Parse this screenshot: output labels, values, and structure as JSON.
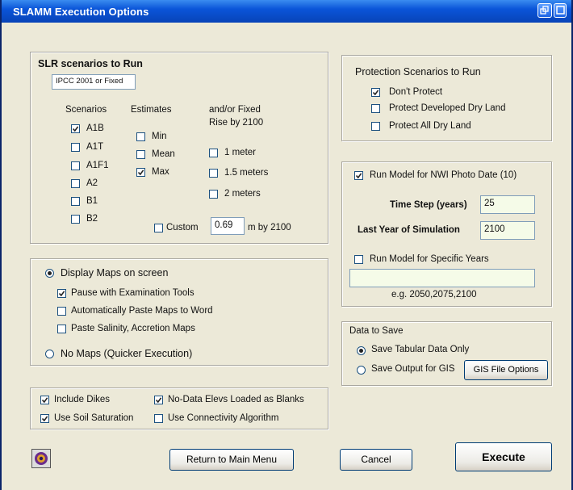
{
  "window": {
    "title": "SLAMM Execution Options"
  },
  "slr": {
    "header": "SLR scenarios to Run",
    "ipcc_box": "IPCC 2001 or Fixed",
    "col_scenarios": "Scenarios",
    "col_estimates": "Estimates",
    "col_fixed_line1": "and/or Fixed",
    "col_fixed_line2": "Rise by 2100",
    "scenarios": [
      {
        "label": "A1B",
        "checked": true
      },
      {
        "label": "A1T",
        "checked": false
      },
      {
        "label": "A1F1",
        "checked": false
      },
      {
        "label": "A2",
        "checked": false
      },
      {
        "label": "B1",
        "checked": false
      },
      {
        "label": "B2",
        "checked": false
      }
    ],
    "estimates": [
      {
        "label": "Min",
        "checked": false
      },
      {
        "label": "Mean",
        "checked": false
      },
      {
        "label": "Max",
        "checked": true
      }
    ],
    "fixed": [
      {
        "label": "1 meter",
        "checked": false
      },
      {
        "label": "1.5 meters",
        "checked": false
      },
      {
        "label": "2 meters",
        "checked": false
      }
    ],
    "custom_label": "Custom",
    "custom_value": "0.69",
    "custom_suffix": "m  by 2100"
  },
  "display": {
    "maps_on_screen": "Display Maps on screen",
    "pause": "Pause with Examination Tools",
    "paste_word": "Automatically Paste Maps to Word",
    "paste_salinity": "Paste Salinity, Accretion Maps",
    "no_maps": "No Maps (Quicker Execution)"
  },
  "options": {
    "include_dikes": "Include Dikes",
    "no_data_elevs": "No-Data Elevs Loaded as Blanks",
    "soil_saturation": "Use Soil Saturation",
    "connectivity": "Use Connectivity Algorithm"
  },
  "protection": {
    "header": "Protection Scenarios to Run",
    "dont_protect": "Don't Protect",
    "protect_developed": "Protect Developed Dry Land",
    "protect_all": "Protect All Dry Land"
  },
  "run": {
    "nwi_label": "Run Model for NWI Photo Date (10)",
    "time_step_label": "Time Step (years)",
    "time_step_value": "25",
    "last_year_label": "Last Year of Simulation",
    "last_year_value": "2100",
    "specific_years_label": "Run Model for Specific Years",
    "specific_years_value": "",
    "example": "e.g. 2050,2075,2100"
  },
  "save": {
    "header": "Data to Save",
    "tabular": "Save Tabular Data Only",
    "gis": "Save Output for GIS",
    "gis_options_button": "GIS File Options"
  },
  "buttons": {
    "return": "Return to Main Menu",
    "cancel": "Cancel",
    "execute": "Execute"
  }
}
